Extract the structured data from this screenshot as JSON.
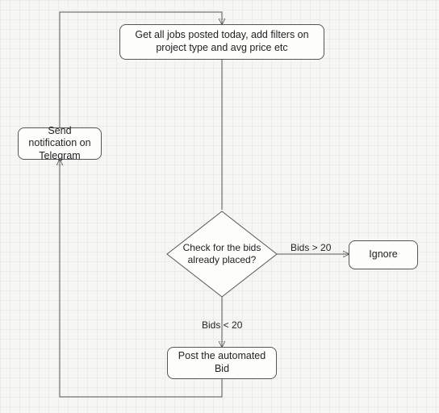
{
  "nodes": {
    "get_jobs": "Get all jobs posted today, add filters on project type and avg price etc",
    "send_notification": "Send notification on Telegram",
    "check_bids": "Check for the bids already placed?",
    "ignore": "Ignore",
    "post_bid": "Post the automated Bid"
  },
  "edges": {
    "bids_gt": "Bids > 20",
    "bids_lt": "Bids < 20"
  }
}
